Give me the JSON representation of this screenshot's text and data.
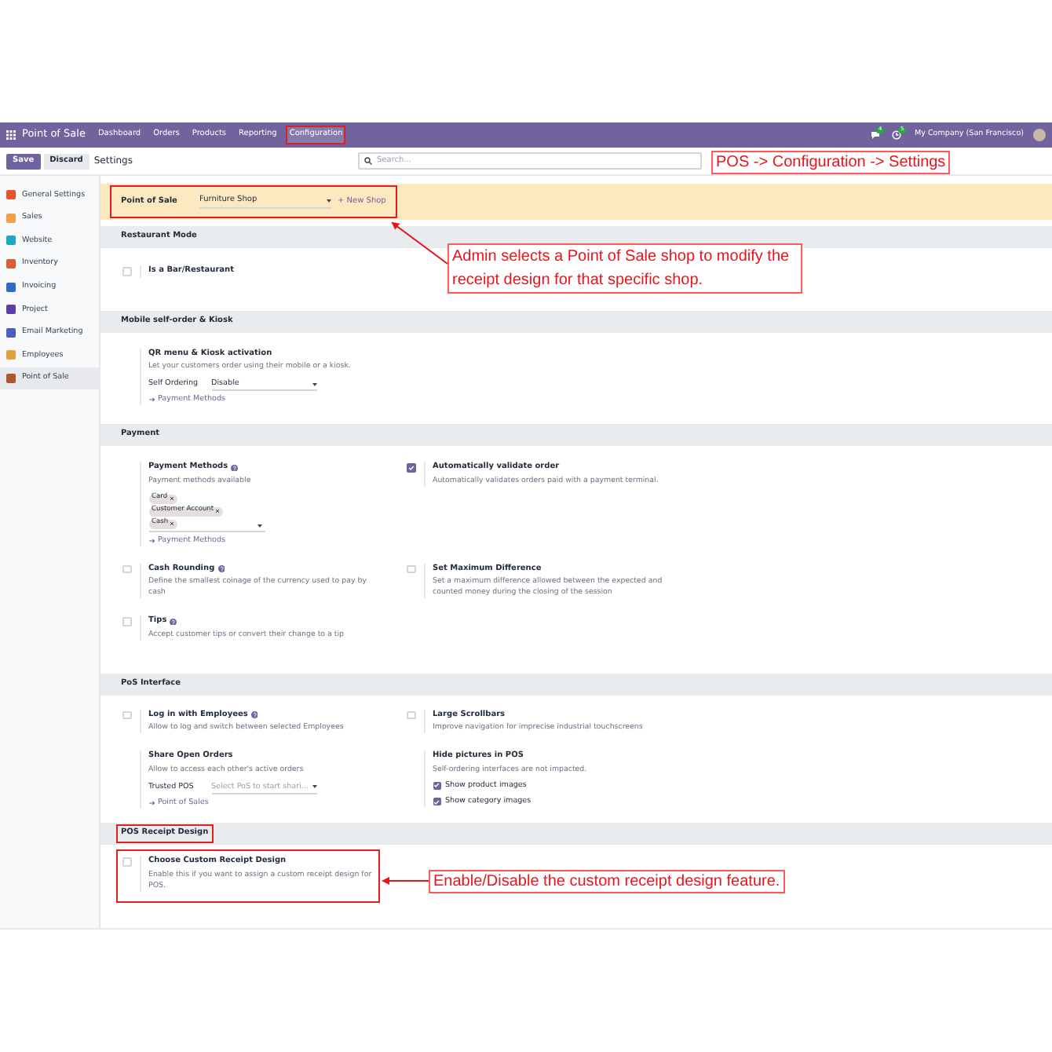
{
  "navbar": {
    "app_name": "Point of Sale",
    "menu": [
      {
        "label": "Dashboard",
        "selected": false,
        "highlighted": false
      },
      {
        "label": "Orders",
        "selected": false,
        "highlighted": false
      },
      {
        "label": "Products",
        "selected": false,
        "highlighted": false
      },
      {
        "label": "Reporting",
        "selected": false,
        "highlighted": false
      },
      {
        "label": "Configuration",
        "selected": true,
        "highlighted": true
      }
    ],
    "chat_badge": "4",
    "activity_badge": "5",
    "company": "My Company (San Francisco)"
  },
  "control_panel": {
    "save": "Save",
    "discard": "Discard",
    "breadcrumb": "Settings",
    "search_placeholder": "Search..."
  },
  "sidebar": {
    "items": [
      {
        "label": "General Settings",
        "color": "#e4572e",
        "selected": false
      },
      {
        "label": "Sales",
        "color": "#f29e4c",
        "selected": false
      },
      {
        "label": "Website",
        "color": "#1ba8c6",
        "selected": false
      },
      {
        "label": "Inventory",
        "color": "#d95d39",
        "selected": false
      },
      {
        "label": "Invoicing",
        "color": "#2b6cc4",
        "selected": false
      },
      {
        "label": "Project",
        "color": "#5b3fa5",
        "selected": false
      },
      {
        "label": "Email Marketing",
        "color": "#4a5fc1",
        "selected": false
      },
      {
        "label": "Employees",
        "color": "#e2a23b",
        "selected": false
      },
      {
        "label": "Point of Sale",
        "color": "#b0562b",
        "selected": true
      }
    ]
  },
  "shop_bar": {
    "label": "Point of Sale",
    "shop": "Furniture Shop",
    "new_shop": "+ New Shop",
    "highlighted": true
  },
  "sections": [
    {
      "title": "Restaurant Mode",
      "highlighted": false,
      "settings": [
        {
          "kind": "checkbox",
          "checked": false,
          "title": "Is a Bar/Restaurant",
          "help_icon": false,
          "highlighted": false
        }
      ]
    },
    {
      "title": "Mobile self-order & Kiosk",
      "highlighted": false,
      "settings": [
        {
          "kind": "plain",
          "title": "QR menu & Kiosk activation",
          "help_icon": false,
          "highlighted": false,
          "description": "Let your customers order using their mobile or a kiosk.",
          "fields": [
            {
              "label": "Self Ordering",
              "value": "Disable"
            }
          ],
          "link": "Payment Methods"
        }
      ]
    },
    {
      "title": "Payment",
      "highlighted": false,
      "settings": [
        {
          "kind": "plain",
          "title": "Payment Methods",
          "help_icon": true,
          "highlighted": false,
          "description": "Payment methods available",
          "tags": [
            "Card",
            "Customer Account",
            "Cash"
          ],
          "link": "Payment Methods"
        },
        {
          "kind": "checkbox",
          "checked": true,
          "title": "Automatically validate order",
          "help_icon": false,
          "highlighted": false,
          "description": "Automatically validates orders paid with a payment terminal."
        },
        {
          "kind": "checkbox",
          "checked": false,
          "title": "Cash Rounding",
          "help_icon": true,
          "highlighted": false,
          "description": "Define the smallest coinage of the currency used to pay by cash"
        },
        {
          "kind": "checkbox",
          "checked": false,
          "title": "Set Maximum Difference",
          "help_icon": false,
          "highlighted": false,
          "description": "Set a maximum difference allowed between the expected and counted money during the closing of the session"
        },
        {
          "kind": "checkbox",
          "checked": false,
          "title": "Tips",
          "help_icon": true,
          "highlighted": false,
          "description": "Accept customer tips or convert their change to a tip"
        }
      ]
    },
    {
      "title": "PoS Interface",
      "highlighted": false,
      "settings": [
        {
          "kind": "checkbox",
          "checked": false,
          "title": "Log in with Employees",
          "help_icon": true,
          "highlighted": false,
          "description": "Allow to log and switch between selected Employees"
        },
        {
          "kind": "checkbox",
          "checked": false,
          "title": "Large Scrollbars",
          "help_icon": false,
          "highlighted": false,
          "description": "Improve navigation for imprecise industrial touchscreens"
        },
        {
          "kind": "plain",
          "title": "Share Open Orders",
          "help_icon": false,
          "highlighted": false,
          "description": "Allow to access each other's active orders",
          "fields": [
            {
              "label": "Trusted POS",
              "placeholder": "Select PoS to start shari..."
            }
          ],
          "link": "Point of Sales"
        },
        {
          "kind": "plain",
          "title": "Hide pictures in POS",
          "help_icon": false,
          "highlighted": false,
          "description": "Self-ordering interfaces are not impacted.",
          "options": [
            {
              "label": "Show product images",
              "checked": true
            },
            {
              "label": "Show category images",
              "checked": true
            }
          ]
        }
      ]
    },
    {
      "title": "POS Receipt Design",
      "highlighted": true,
      "settings": [
        {
          "kind": "checkbox",
          "checked": false,
          "title": "Choose Custom Receipt Design",
          "help_icon": false,
          "highlighted": true,
          "description": "Enable this if you want to assign a custom receipt design for POS."
        }
      ]
    }
  ],
  "annotations": [
    {
      "kind": "label",
      "text": "POS -> Configuration -> Settings"
    },
    {
      "kind": "callout",
      "text": "Admin selects a Point of Sale shop to modify the receipt design for that specific shop."
    },
    {
      "kind": "callout",
      "text": "Enable/Disable the custom receipt design feature."
    }
  ]
}
